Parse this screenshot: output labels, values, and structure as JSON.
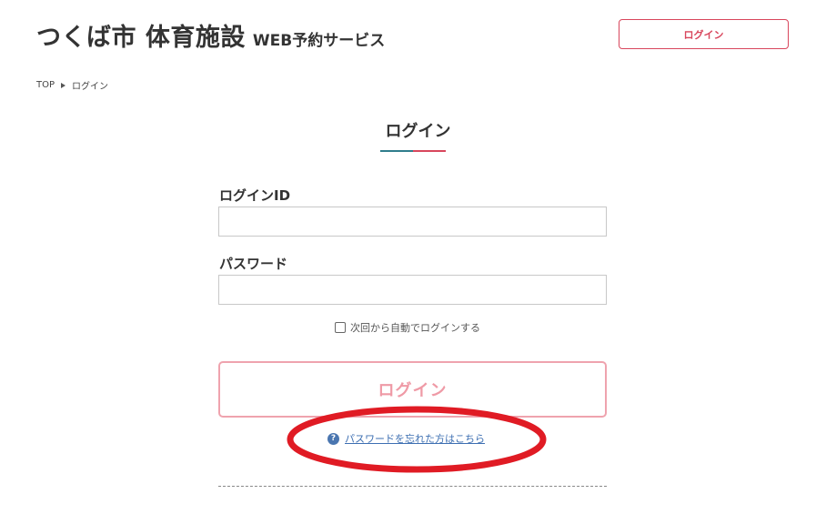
{
  "header": {
    "site_title_main": "つくば市 体育施設",
    "site_title_sub": "WEB予約サービス",
    "login_button_label": "ログイン"
  },
  "breadcrumb": {
    "home": "TOP",
    "current": "ログイン"
  },
  "page": {
    "title": "ログイン"
  },
  "form": {
    "login_id_label": "ログインID",
    "login_id_value": "",
    "password_label": "パスワード",
    "password_value": "",
    "remember_label": "次回から自動でログインする",
    "remember_checked": false,
    "submit_label": "ログイン",
    "forgot_link_label": "パスワードを忘れた方はこちら"
  },
  "icons": {
    "help": "question-circle-icon"
  },
  "colors": {
    "accent_red": "#d8465c",
    "accent_teal": "#2f7d8c",
    "submit_disabled": "#ef9aa6",
    "link_blue": "#3d6fb2",
    "annotation_red": "#e01b24"
  }
}
